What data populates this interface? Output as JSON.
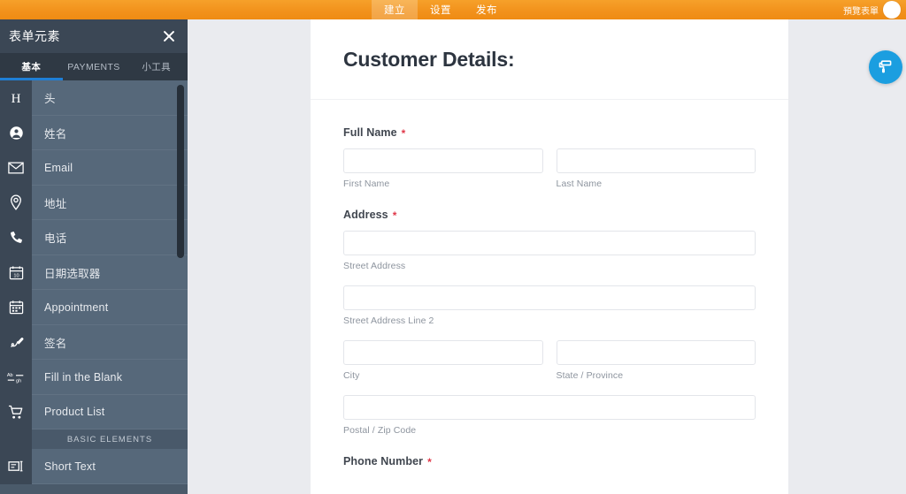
{
  "topbar": {
    "tabs": [
      {
        "label": "建立",
        "active": true
      },
      {
        "label": "设置",
        "active": false
      },
      {
        "label": "发布",
        "active": false
      }
    ],
    "preview_label": "預覽表單",
    "toggle_icon": "toggle-circle-icon",
    "background_color": "#f2921c"
  },
  "left_panel": {
    "title": "表单元素",
    "close_icon": "close-icon",
    "tabs": [
      {
        "label": "基本",
        "active": true
      },
      {
        "label": "PAYMENTS",
        "active": false
      },
      {
        "label": "小工具",
        "active": false
      }
    ],
    "active_tab_underline_color": "#1f7fd6",
    "elements": [
      {
        "label": "头",
        "icon": "heading-h-icon"
      },
      {
        "label": "姓名",
        "icon": "person-circle-icon"
      },
      {
        "label": "Email",
        "icon": "envelope-icon"
      },
      {
        "label": "地址",
        "icon": "map-pin-icon"
      },
      {
        "label": "电话",
        "icon": "phone-icon"
      },
      {
        "label": "日期选取器",
        "icon": "calendar-date-icon"
      },
      {
        "label": "Appointment",
        "icon": "calendar-appointment-icon"
      },
      {
        "label": "签名",
        "icon": "signature-pen-icon"
      },
      {
        "label": "Fill in the Blank",
        "icon": "fill-in-blank-icon"
      },
      {
        "label": "Product List",
        "icon": "shopping-cart-icon"
      }
    ],
    "section_heading": "BASIC ELEMENTS",
    "basic_elements": [
      {
        "label": "Short Text",
        "icon": "short-text-icon"
      }
    ],
    "scrollbar": "vertical-scrollbar"
  },
  "form": {
    "title": "Customer Details:",
    "fields": [
      {
        "label": "Full Name",
        "required_marker": "*",
        "inputs": [
          {
            "value": "",
            "placeholder": "",
            "sublabel": "First Name",
            "name": "first-name-input"
          },
          {
            "value": "",
            "placeholder": "",
            "sublabel": "Last Name",
            "name": "last-name-input"
          }
        ]
      },
      {
        "label": "Address",
        "required_marker": "*",
        "inputs": [
          {
            "value": "",
            "placeholder": "",
            "sublabel": "Street Address",
            "name": "street-address-input"
          },
          {
            "value": "",
            "placeholder": "",
            "sublabel": "Street Address Line 2",
            "name": "street-address-2-input"
          },
          {
            "value": "",
            "placeholder": "",
            "sublabel": "City",
            "name": "city-input"
          },
          {
            "value": "",
            "placeholder": "",
            "sublabel": "State / Province",
            "name": "state-province-input"
          },
          {
            "value": "",
            "placeholder": "",
            "sublabel": "Postal / Zip Code",
            "name": "postal-zip-input"
          }
        ]
      },
      {
        "label": "Phone Number",
        "required_marker": "*",
        "inputs": []
      }
    ]
  },
  "floating_button": {
    "icon": "paint-roller-icon",
    "color": "#1b9ee0"
  }
}
